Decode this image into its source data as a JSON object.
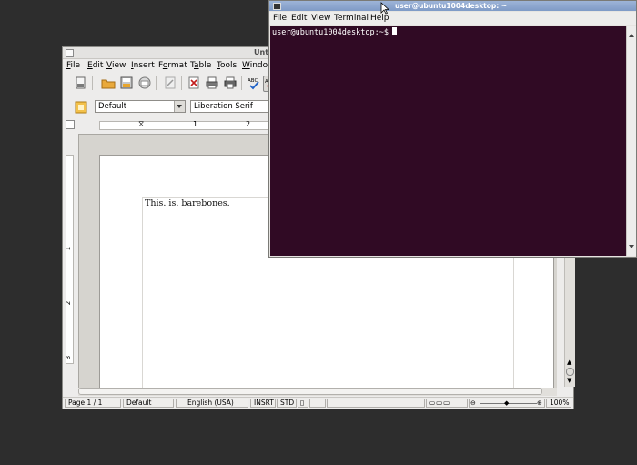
{
  "writer": {
    "title": "Untitl",
    "menu": [
      "File",
      "Edit",
      "View",
      "Insert",
      "Format",
      "Table",
      "Tools",
      "Window"
    ],
    "menu_mnemonics": [
      "F",
      "E",
      "V",
      "I",
      "o",
      "a",
      "T",
      "W"
    ],
    "paragraph_style": "Default",
    "font_name": "Liberation Serif",
    "ruler_numbers": [
      "1",
      "2"
    ],
    "vruler_numbers": [
      "1",
      "2",
      "3"
    ],
    "document_text": "This. is. barebones.",
    "status": {
      "page": "Page 1 / 1",
      "style": "Default",
      "language": "English (USA)",
      "insert_mode": "INSRT",
      "selection_mode": "STD",
      "zoom": "100%"
    }
  },
  "terminal": {
    "title": "user@ubuntu1004desktop: ~",
    "menu": [
      "File",
      "Edit",
      "View",
      "Terminal",
      "Help"
    ],
    "prompt": "user@ubuntu1004desktop:~$",
    "background_color": "#300a24"
  },
  "icons": [
    "new-document-icon",
    "open-folder-icon",
    "save-icon",
    "email-icon",
    "edit-file-icon",
    "export-pdf-icon",
    "print-icon",
    "print-preview-icon",
    "spellcheck-icon",
    "autospell-icon",
    "styles-icon"
  ]
}
